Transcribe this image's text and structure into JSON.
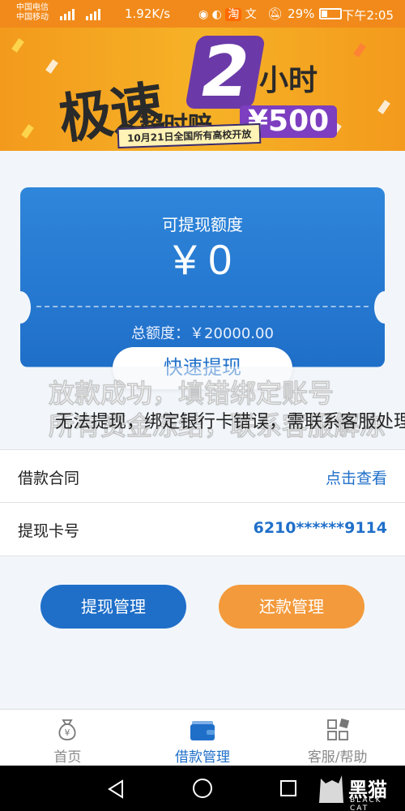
{
  "status_bar": {
    "carrier_1": "中国电信",
    "carrier_2": "中国移动",
    "signal_text": "²⁶ ⁴⁶",
    "net_speed": "1.92K/s",
    "battery": "29%",
    "time": "下午2:05"
  },
  "banner": {
    "headline": "极速",
    "number": "2",
    "hours": "小时",
    "sub": "超时赔",
    "amount": "¥500",
    "note": "10月21日全国所有高校开放"
  },
  "card": {
    "label": "可提现额度",
    "amount": "¥ 0",
    "total": "总额度：￥20000.00",
    "withdraw_button": "快速提现"
  },
  "watermark": {
    "line1": "放款成功，填错绑定账号",
    "line2": "所有资金冻结，联系客服解冻",
    "line3": "无法提现，绑定银行卡错误，需联系客服处理"
  },
  "list": {
    "contract_label": "借款合同",
    "contract_link": "点击查看",
    "card_label": "提现卡号",
    "card_number": "6210******9114"
  },
  "buttons": {
    "withdraw_mgmt": "提现管理",
    "repay_mgmt": "还款管理"
  },
  "tabs": [
    {
      "label": "首页",
      "icon": "money-bag-icon"
    },
    {
      "label": "借款管理",
      "icon": "wallet-icon"
    },
    {
      "label": "客服/帮助",
      "icon": "apps-grid-icon"
    }
  ],
  "brand": {
    "name": "黑猫",
    "sub": "BLACK CAT"
  },
  "colors": {
    "primary": "#1f6fc9",
    "accent": "#f39a3c",
    "status_bar": "#f18a1a"
  }
}
